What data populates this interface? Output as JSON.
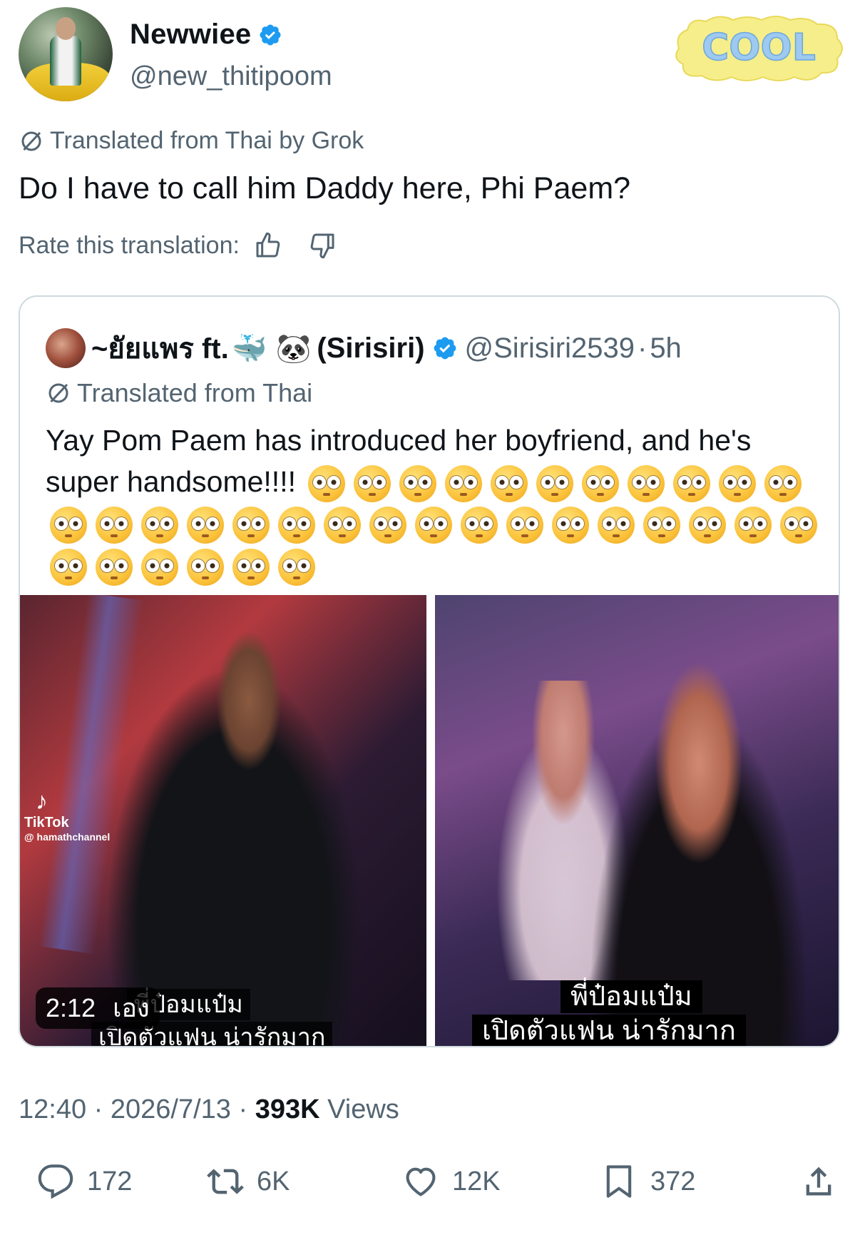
{
  "author": {
    "display_name": "Newwiee",
    "handle": "@new_thitipoom"
  },
  "sticker": {
    "text": "COOL"
  },
  "translation": {
    "label": "Translated from Thai by Grok",
    "text": "Do I have to call him Daddy here, Phi Paem?",
    "rate_label": "Rate this translation:"
  },
  "quote": {
    "name": "~ยัยแพร ft.",
    "name_suffix": "(Sirisiri)",
    "handle": "@Sirisiri2539",
    "separator": "·",
    "time": "5h",
    "translated_label": "Translated from Thai",
    "text": "Yay Pom Paem has introduced her boyfriend, and he's super handsome!!!!",
    "emoji_count": 34,
    "media": {
      "left": {
        "duration": "2:12",
        "tiktok_brand": "TikTok",
        "tiktok_user": "@ hamathchannel",
        "caption_line1": "พี่ป๋อมแป๋ม",
        "caption_line2": "เปิดตัวแฟน น่ารักมาก",
        "caption_overlay": "เอง"
      },
      "right": {
        "caption_line1": "พี่ป๋อมแป๋ม",
        "caption_line2": "เปิดตัวแฟน น่ารักมาก"
      }
    }
  },
  "meta": {
    "time": "12:40",
    "sep1": "·",
    "date": "2026/7/13",
    "sep2": "·",
    "views_count": "393K",
    "views_label": "Views"
  },
  "actions": {
    "replies": "172",
    "reposts": "6K",
    "likes": "12K",
    "bookmarks": "372"
  },
  "colors": {
    "verified_blue": "#1d9bf0",
    "secondary_text": "#536471",
    "primary_text": "#0f1419",
    "border": "#cfd9de"
  }
}
